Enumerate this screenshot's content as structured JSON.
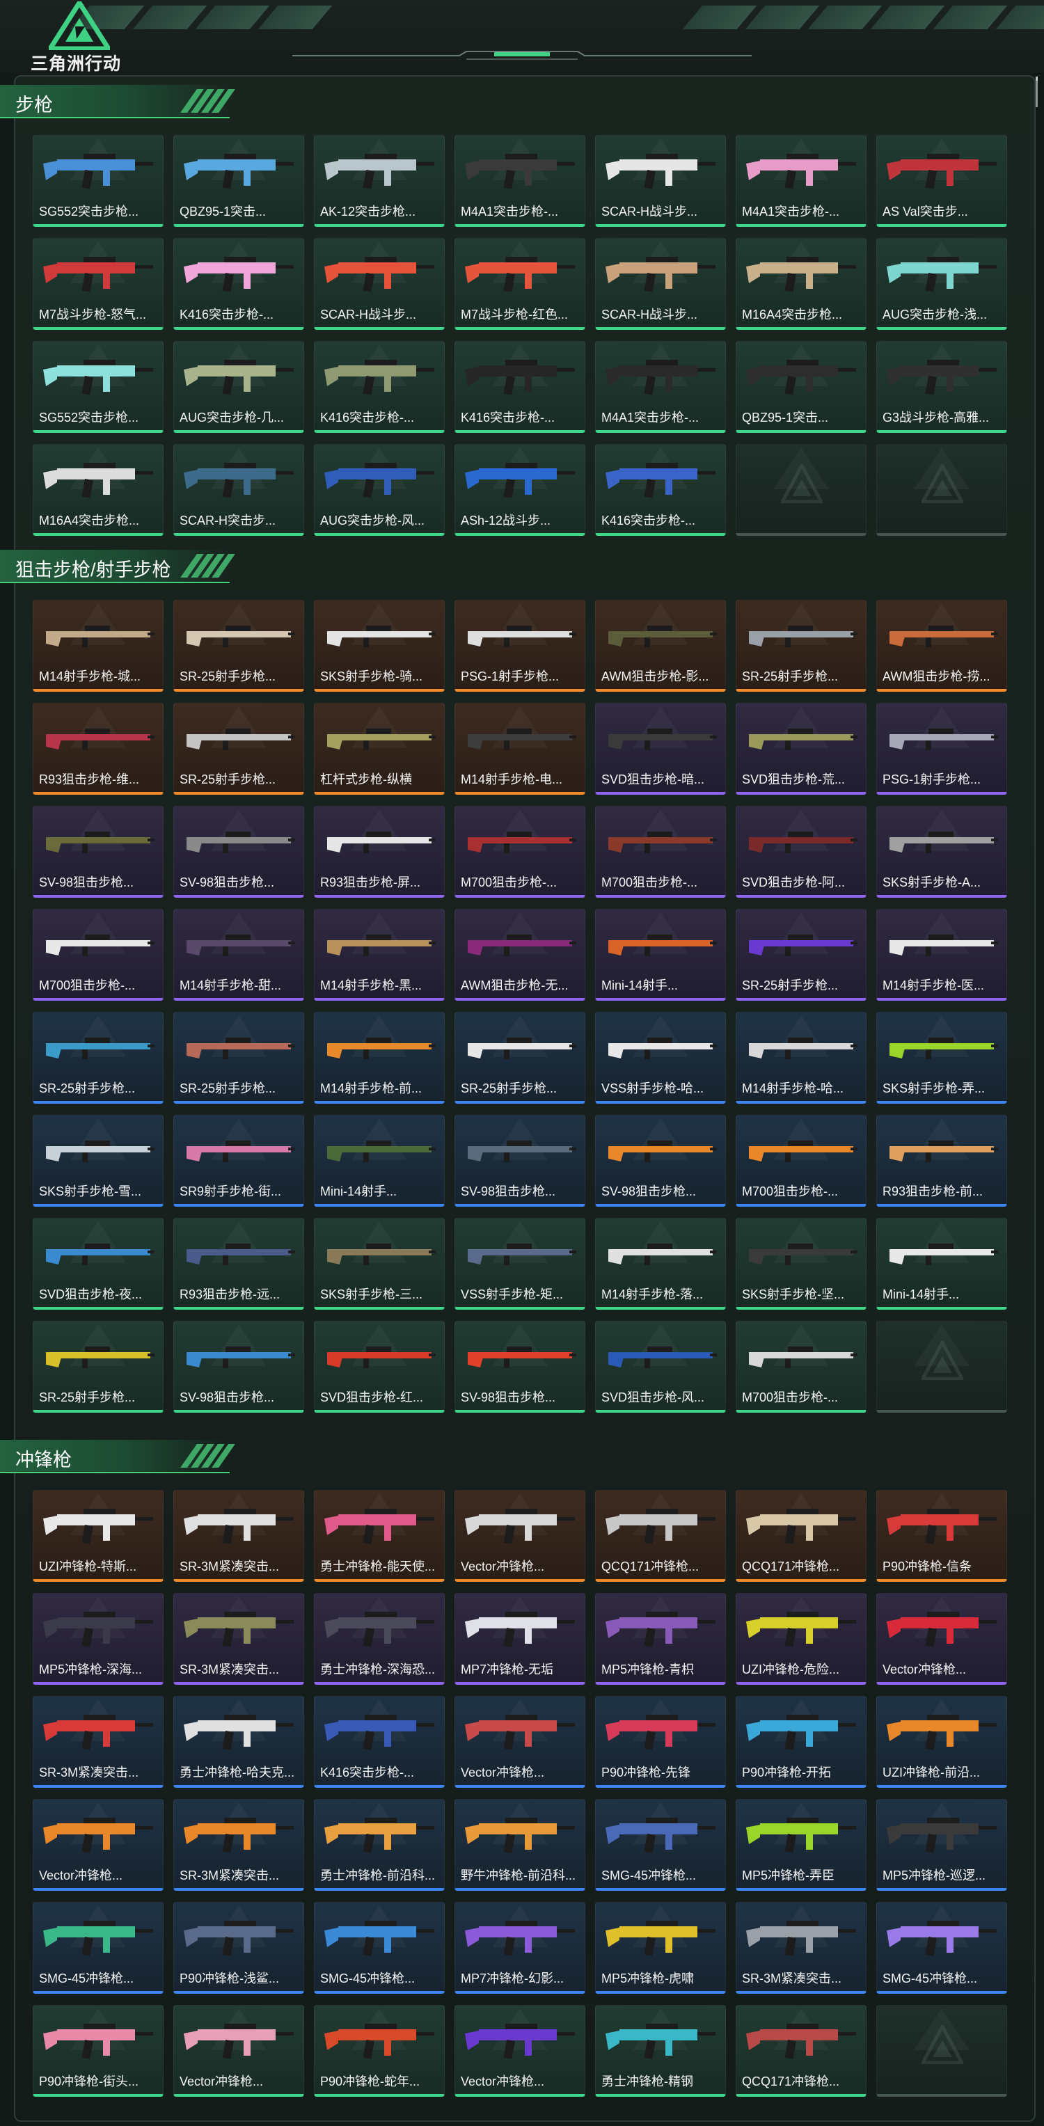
{
  "logo": {
    "text": "三角洲行动"
  },
  "sections": [
    {
      "title": "步枪",
      "items": [
        {
          "name": "SG552突击步枪...",
          "rarity": "green",
          "color": "#4a90d6"
        },
        {
          "name": "QBZ95-1突击...",
          "rarity": "green",
          "color": "#5aa8e0"
        },
        {
          "name": "AK-12突击步枪...",
          "rarity": "green",
          "color": "#b9c6cc"
        },
        {
          "name": "M4A1突击步枪-...",
          "rarity": "green",
          "color": "#3a3a3a"
        },
        {
          "name": "SCAR-H战斗步...",
          "rarity": "green",
          "color": "#e6e6e6"
        },
        {
          "name": "M4A1突击步枪-...",
          "rarity": "green",
          "color": "#e89cc8"
        },
        {
          "name": "AS Val突击步...",
          "rarity": "green",
          "color": "#c0343c"
        },
        {
          "name": "M7战斗步枪-怒气...",
          "rarity": "green",
          "color": "#d13a3a"
        },
        {
          "name": "K416突击步枪-...",
          "rarity": "green",
          "color": "#f0a6d8"
        },
        {
          "name": "SCAR-H战斗步...",
          "rarity": "green",
          "color": "#e4533a"
        },
        {
          "name": "M7战斗步枪-红色...",
          "rarity": "green",
          "color": "#e5553b"
        },
        {
          "name": "SCAR-H战斗步...",
          "rarity": "green",
          "color": "#c9a27c"
        },
        {
          "name": "M16A4突击步枪...",
          "rarity": "green",
          "color": "#c8b08a"
        },
        {
          "name": "AUG突击步枪-浅...",
          "rarity": "green",
          "color": "#7fd6cf"
        },
        {
          "name": "SG552突击步枪...",
          "rarity": "green",
          "color": "#8de0dc"
        },
        {
          "name": "AUG突击步枪-几...",
          "rarity": "green",
          "color": "#a9b48c"
        },
        {
          "name": "K416突击步枪-...",
          "rarity": "green",
          "color": "#8f9a72"
        },
        {
          "name": "K416突击步枪-...",
          "rarity": "green",
          "color": "#262626"
        },
        {
          "name": "M4A1突击步枪-...",
          "rarity": "green",
          "color": "#2a2a2a"
        },
        {
          "name": "QBZ95-1突击...",
          "rarity": "green",
          "color": "#2d2d2d"
        },
        {
          "name": "G3战斗步枪-高雅...",
          "rarity": "green",
          "color": "#303030"
        },
        {
          "name": "M16A4突击步枪...",
          "rarity": "green",
          "color": "#dcdcdc"
        },
        {
          "name": "SCAR-H突击步...",
          "rarity": "green",
          "color": "#3d6b8c"
        },
        {
          "name": "AUG突击步枪-风...",
          "rarity": "green",
          "color": "#2f5db8"
        },
        {
          "name": "ASh-12战斗步...",
          "rarity": "green",
          "color": "#2a6ad0"
        },
        {
          "name": "K416突击步枪-...",
          "rarity": "green",
          "color": "#3a64c8"
        },
        {
          "empty": true
        },
        {
          "empty": true
        }
      ]
    },
    {
      "title": "狙击步枪/射手步枪",
      "items": [
        {
          "name": "M14射手步枪-城...",
          "rarity": "orange",
          "color": "#c2a98a"
        },
        {
          "name": "SR-25射手步枪...",
          "rarity": "orange",
          "color": "#d6c7b2"
        },
        {
          "name": "SKS射手步枪-骑...",
          "rarity": "orange",
          "color": "#e4e4e4"
        },
        {
          "name": "PSG-1射手步枪...",
          "rarity": "orange",
          "color": "#dedede"
        },
        {
          "name": "AWM狙击步枪-影...",
          "rarity": "orange",
          "color": "#5b5d3a"
        },
        {
          "name": "SR-25射手步枪...",
          "rarity": "orange",
          "color": "#9aa0a8"
        },
        {
          "name": "AWM狙击步枪-捞...",
          "rarity": "orange",
          "color": "#c96b3a"
        },
        {
          "name": "R93狙击步枪-维...",
          "rarity": "orange",
          "color": "#b8344a"
        },
        {
          "name": "SR-25射手步枪...",
          "rarity": "orange",
          "color": "#c4c4c4"
        },
        {
          "name": "杠杆式步枪-纵横",
          "rarity": "orange",
          "color": "#a4a060"
        },
        {
          "name": "M14射手步枪-电...",
          "rarity": "orange",
          "color": "#3d3d3d"
        },
        {
          "name": "SVD狙击步枪-暗...",
          "rarity": "purple",
          "color": "#3a3a3a"
        },
        {
          "name": "SVD狙击步枪-荒...",
          "rarity": "purple",
          "color": "#9a9a5a"
        },
        {
          "name": "PSG-1射手步枪...",
          "rarity": "purple",
          "color": "#a8a8b8"
        },
        {
          "name": "SV-98狙击步枪...",
          "rarity": "purple",
          "color": "#6a6a3a"
        },
        {
          "name": "SV-98狙击步枪...",
          "rarity": "purple",
          "color": "#8a8a8a"
        },
        {
          "name": "R93狙击步枪-屏...",
          "rarity": "purple",
          "color": "#e6e6e6"
        },
        {
          "name": "M700狙击步枪-...",
          "rarity": "purple",
          "color": "#a83030"
        },
        {
          "name": "M700狙击步枪-...",
          "rarity": "purple",
          "color": "#8a3a2a"
        },
        {
          "name": "SVD狙击步枪-阿...",
          "rarity": "purple",
          "color": "#7a2a2a"
        },
        {
          "name": "SKS射手步枪-A...",
          "rarity": "purple",
          "color": "#a0a0a0"
        },
        {
          "name": "M700狙击步枪-...",
          "rarity": "purple",
          "color": "#e8e8e8"
        },
        {
          "name": "M14射手步枪-甜...",
          "rarity": "purple",
          "color": "#5a4a6a"
        },
        {
          "name": "M14射手步枪-黑...",
          "rarity": "purple",
          "color": "#b8905a"
        },
        {
          "name": "AWM狙击步枪-无...",
          "rarity": "purple",
          "color": "#8a2a7a"
        },
        {
          "name": "Mini-14射手...",
          "rarity": "purple",
          "color": "#d8642a"
        },
        {
          "name": "SR-25射手步枪...",
          "rarity": "purple",
          "color": "#6a3ad0"
        },
        {
          "name": "M14射手步枪-医...",
          "rarity": "purple",
          "color": "#e8e8e8"
        },
        {
          "name": "SR-25射手步枪...",
          "rarity": "blue",
          "color": "#3a9ac8"
        },
        {
          "name": "SR-25射手步枪...",
          "rarity": "blue",
          "color": "#b86a5a"
        },
        {
          "name": "M14射手步枪-前...",
          "rarity": "blue",
          "color": "#e88a2a"
        },
        {
          "name": "SR-25射手步枪...",
          "rarity": "blue",
          "color": "#e6e6e6"
        },
        {
          "name": "VSS射手步枪-哈...",
          "rarity": "blue",
          "color": "#e8e8e8"
        },
        {
          "name": "M14射手步枪-哈...",
          "rarity": "blue",
          "color": "#d8d8d8"
        },
        {
          "name": "SKS射手步枪-弄...",
          "rarity": "blue",
          "color": "#9ad62a"
        },
        {
          "name": "SKS射手步枪-雪...",
          "rarity": "blue",
          "color": "#c8d0d8"
        },
        {
          "name": "SR9射手步枪-街...",
          "rarity": "blue",
          "color": "#d87aa8"
        },
        {
          "name": "Mini-14射手...",
          "rarity": "blue",
          "color": "#4a6a3a"
        },
        {
          "name": "SV-98狙击步枪...",
          "rarity": "blue",
          "color": "#5a6a7a"
        },
        {
          "name": "SV-98狙击步枪...",
          "rarity": "blue",
          "color": "#e8882a"
        },
        {
          "name": "M700狙击步枪-...",
          "rarity": "blue",
          "color": "#e8882a"
        },
        {
          "name": "R93狙击步枪-前...",
          "rarity": "blue",
          "color": "#e0a060"
        },
        {
          "name": "SVD狙击步枪-夜...",
          "rarity": "green",
          "color": "#3a8ad0"
        },
        {
          "name": "R93狙击步枪-远...",
          "rarity": "green",
          "color": "#4a5a8a"
        },
        {
          "name": "SKS射手步枪-三...",
          "rarity": "green",
          "color": "#8a7a5a"
        },
        {
          "name": "VSS射手步枪-矩...",
          "rarity": "green",
          "color": "#5a6a8a"
        },
        {
          "name": "M14射手步枪-落...",
          "rarity": "green",
          "color": "#e0e0e0"
        },
        {
          "name": "SKS射手步枪-坚...",
          "rarity": "green",
          "color": "#3a3a3a"
        },
        {
          "name": "Mini-14射手...",
          "rarity": "green",
          "color": "#e8e8e8"
        },
        {
          "name": "SR-25射手步枪...",
          "rarity": "green",
          "color": "#d8c02a"
        },
        {
          "name": "SV-98狙击步枪...",
          "rarity": "green",
          "color": "#3a8ad0"
        },
        {
          "name": "SVD狙击步枪-红...",
          "rarity": "green",
          "color": "#d83a2a"
        },
        {
          "name": "SV-98狙击步枪...",
          "rarity": "green",
          "color": "#e0402a"
        },
        {
          "name": "SVD狙击步枪-风...",
          "rarity": "green",
          "color": "#2a5ab8"
        },
        {
          "name": "M700狙击步枪-...",
          "rarity": "green",
          "color": "#d8d8d8"
        },
        {
          "empty": true
        }
      ]
    },
    {
      "title": "冲锋枪",
      "items": [
        {
          "name": "UZI冲锋枪-特斯...",
          "rarity": "orange",
          "color": "#e8e8e8"
        },
        {
          "name": "SR-3M紧凑突击...",
          "rarity": "orange",
          "color": "#e0e0e0"
        },
        {
          "name": "勇士冲锋枪-能天使...",
          "rarity": "orange",
          "color": "#e05a8a"
        },
        {
          "name": "Vector冲锋枪...",
          "rarity": "orange",
          "color": "#d8d8d8"
        },
        {
          "name": "QCQ171冲锋枪...",
          "rarity": "orange",
          "color": "#c8c8c8"
        },
        {
          "name": "QCQ171冲锋枪...",
          "rarity": "orange",
          "color": "#d8c8a8"
        },
        {
          "name": "P90冲锋枪-信条",
          "rarity": "orange",
          "color": "#d83a3a"
        },
        {
          "name": "MP5冲锋枪-深海...",
          "rarity": "purple",
          "color": "#3a3a4a"
        },
        {
          "name": "SR-3M紧凑突击...",
          "rarity": "purple",
          "color": "#8a8a5a"
        },
        {
          "name": "勇士冲锋枪-深海恐...",
          "rarity": "purple",
          "color": "#4a4a5a"
        },
        {
          "name": "MP7冲锋枪-无垢",
          "rarity": "purple",
          "color": "#e0e0e8"
        },
        {
          "name": "MP5冲锋枪-青枳",
          "rarity": "purple",
          "color": "#8a5ab8"
        },
        {
          "name": "UZI冲锋枪-危险...",
          "rarity": "purple",
          "color": "#d8d02a"
        },
        {
          "name": "Vector冲锋枪...",
          "rarity": "purple",
          "color": "#d82a3a"
        },
        {
          "name": "SR-3M紧凑突击...",
          "rarity": "blue",
          "color": "#d83a3a"
        },
        {
          "name": "勇士冲锋枪-哈夫克...",
          "rarity": "blue",
          "color": "#e0e0e0"
        },
        {
          "name": "K416突击步枪-...",
          "rarity": "blue",
          "color": "#3a5ab8"
        },
        {
          "name": "Vector冲锋枪...",
          "rarity": "blue",
          "color": "#c84a4a"
        },
        {
          "name": "P90冲锋枪-先锋",
          "rarity": "blue",
          "color": "#d83a5a"
        },
        {
          "name": "P90冲锋枪-开拓",
          "rarity": "blue",
          "color": "#3aa8d8"
        },
        {
          "name": "UZI冲锋枪-前沿...",
          "rarity": "blue",
          "color": "#e8882a"
        },
        {
          "name": "Vector冲锋枪...",
          "rarity": "blue",
          "color": "#e8882a"
        },
        {
          "name": "SR-3M紧凑突击...",
          "rarity": "blue",
          "color": "#e8882a"
        },
        {
          "name": "勇士冲锋枪-前沿科...",
          "rarity": "blue",
          "color": "#e8a040"
        },
        {
          "name": "野牛冲锋枪-前沿科...",
          "rarity": "blue",
          "color": "#e89a3a"
        },
        {
          "name": "SMG-45冲锋枪...",
          "rarity": "blue",
          "color": "#4a6ab8"
        },
        {
          "name": "MP5冲锋枪-弄臣",
          "rarity": "blue",
          "color": "#9ad62a"
        },
        {
          "name": "MP5冲锋枪-巡逻...",
          "rarity": "blue",
          "color": "#3a3a3a"
        },
        {
          "name": "SMG-45冲锋枪...",
          "rarity": "blue",
          "color": "#3ab88a"
        },
        {
          "name": "P90冲锋枪-浅鲨...",
          "rarity": "blue",
          "color": "#5a6a8a"
        },
        {
          "name": "SMG-45冲锋枪...",
          "rarity": "blue",
          "color": "#3a8ad8"
        },
        {
          "name": "MP7冲锋枪-幻影...",
          "rarity": "blue",
          "color": "#8a5ad8"
        },
        {
          "name": "MP5冲锋枪-虎啸",
          "rarity": "blue",
          "color": "#e0c02a"
        },
        {
          "name": "SR-3M紧凑突击...",
          "rarity": "blue",
          "color": "#9aa0a8"
        },
        {
          "name": "SMG-45冲锋枪...",
          "rarity": "blue",
          "color": "#9a7ae8"
        },
        {
          "name": "P90冲锋枪-街头...",
          "rarity": "green",
          "color": "#e88aa8"
        },
        {
          "name": "Vector冲锋枪...",
          "rarity": "green",
          "color": "#e8a0b8"
        },
        {
          "name": "P90冲锋枪-蛇年...",
          "rarity": "green",
          "color": "#d84a2a"
        },
        {
          "name": "Vector冲锋枪...",
          "rarity": "green",
          "color": "#6a3ad0"
        },
        {
          "name": "勇士冲锋枪-精钢",
          "rarity": "green",
          "color": "#3ab8c8"
        },
        {
          "name": "QCQ171冲锋枪...",
          "rarity": "green",
          "color": "#b84a4a"
        },
        {
          "empty": true
        }
      ]
    }
  ]
}
